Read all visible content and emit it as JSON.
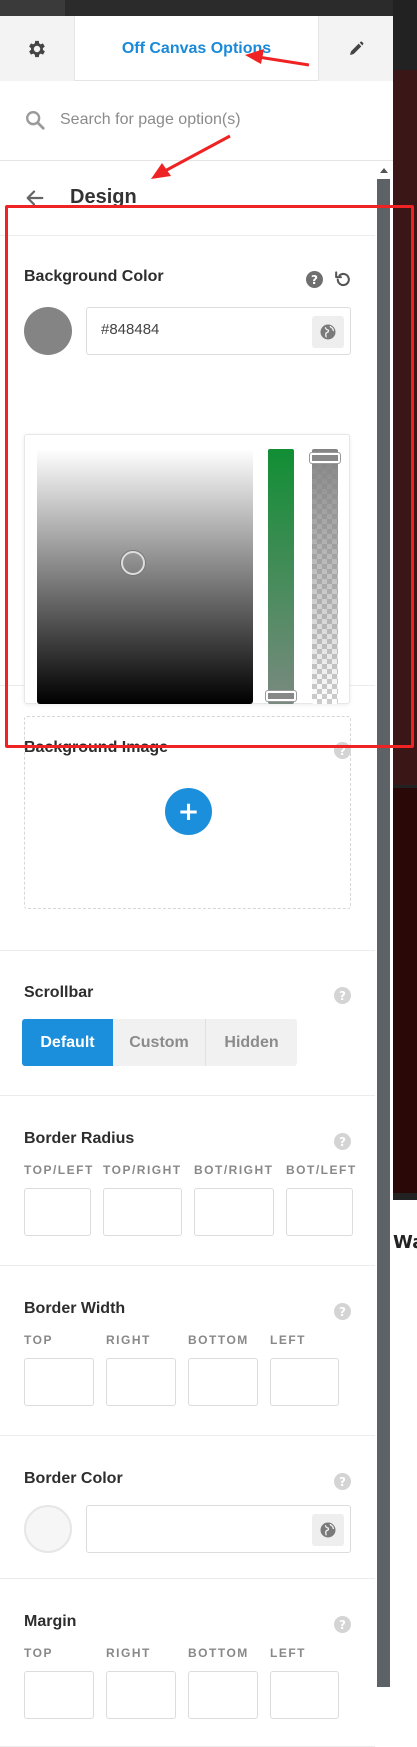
{
  "header": {
    "title": "Off Canvas Options",
    "settings_icon": "gear-icon",
    "design_icon": "pencil-icon"
  },
  "search": {
    "placeholder": "Search for page option(s)",
    "icon": "search-icon"
  },
  "page": {
    "title": "Design",
    "back_icon": "arrow-left-icon"
  },
  "background_color": {
    "label": "Background Color",
    "value": "#848484",
    "swatch_color": "#848484",
    "hue_color": "#118e34"
  },
  "background_image": {
    "label": "Background Image",
    "add_icon": "plus-icon"
  },
  "scrollbar": {
    "label": "Scrollbar",
    "options": [
      "Default",
      "Custom",
      "Hidden"
    ],
    "selected": "Default"
  },
  "border_radius": {
    "label": "Border Radius",
    "fields": [
      "TOP/LEFT",
      "TOP/RIGHT",
      "BOT/RIGHT",
      "BOT/LEFT"
    ]
  },
  "border_width": {
    "label": "Border Width",
    "fields": [
      "TOP",
      "RIGHT",
      "BOTTOM",
      "LEFT"
    ]
  },
  "border_color": {
    "label": "Border Color",
    "value": ""
  },
  "margin": {
    "label": "Margin",
    "fields": [
      "TOP",
      "RIGHT",
      "BOTTOM",
      "LEFT"
    ]
  },
  "background_page": {
    "partial_text": "Wa"
  },
  "colors": {
    "accent": "#1a8ad8",
    "annotation": "#ef2323"
  }
}
